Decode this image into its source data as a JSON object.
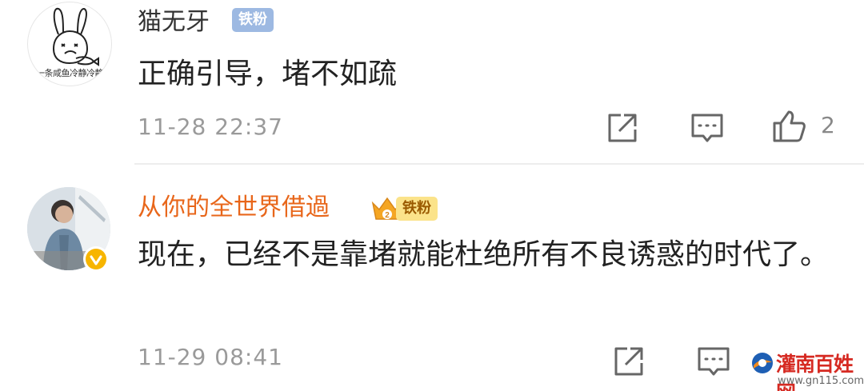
{
  "comments": [
    {
      "avatar_caption": "一条咸鱼冷静冷静",
      "username": "猫无牙",
      "badge": "铁粉",
      "content": "正确引导，堵不如疏",
      "timestamp": "11-28 22:37",
      "like_count": "2"
    },
    {
      "username": "从你的全世界借過",
      "badge": "铁粉",
      "badge_level": "2",
      "content": "现在，已经不是靠堵就能杜绝所有不良诱惑的时代了。",
      "timestamp": "11-29 08:41"
    }
  ],
  "watermark": {
    "text": "灌南百姓网",
    "url": "www.gn115.com"
  },
  "icons": {
    "share": "share-icon",
    "reply": "comment-icon",
    "like": "thumbs-up-icon",
    "verified": "verified-badge-icon",
    "crown": "crown-icon"
  },
  "colors": {
    "username_default": "#333333",
    "username_vip": "#e8661a",
    "badge_blue": "#9db9e2",
    "badge_gold": "#fbe38a",
    "timestamp": "#9a9a9a",
    "watermark": "#d62a22"
  }
}
